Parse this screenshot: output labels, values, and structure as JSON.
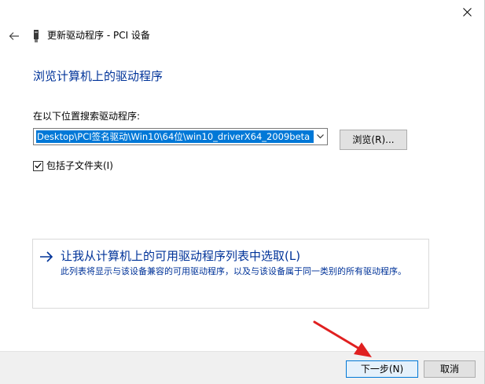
{
  "window": {
    "title": "更新驱动程序 - PCI 设备"
  },
  "main": {
    "heading": "浏览计算机上的驱动程序",
    "path_label": "在以下位置搜索驱动程序:",
    "path_value": "Desktop\\PCI签名驱动\\Win10\\64位\\win10_driverX64_2009beta",
    "browse_label": "浏览(R)...",
    "include_subfolders_label": "包括子文件夹(I)",
    "include_subfolders_checked": true
  },
  "pick_option": {
    "title": "让我从计算机上的可用驱动程序列表中选取(L)",
    "description": "此列表将显示与该设备兼容的可用驱动程序，以及与该设备属于同一类别的所有驱动程序。"
  },
  "footer": {
    "next_label": "下一步(N)",
    "cancel_label": "取消"
  },
  "colors": {
    "link_blue": "#003399",
    "selection_blue": "#0078d7",
    "annotation_red": "#e02020"
  },
  "icons": {
    "close": "close-icon",
    "back": "back-arrow-icon",
    "device": "pci-device-icon",
    "dropdown": "chevron-down-icon",
    "checkbox": "checkmark-icon",
    "pick": "arrow-right-icon"
  }
}
